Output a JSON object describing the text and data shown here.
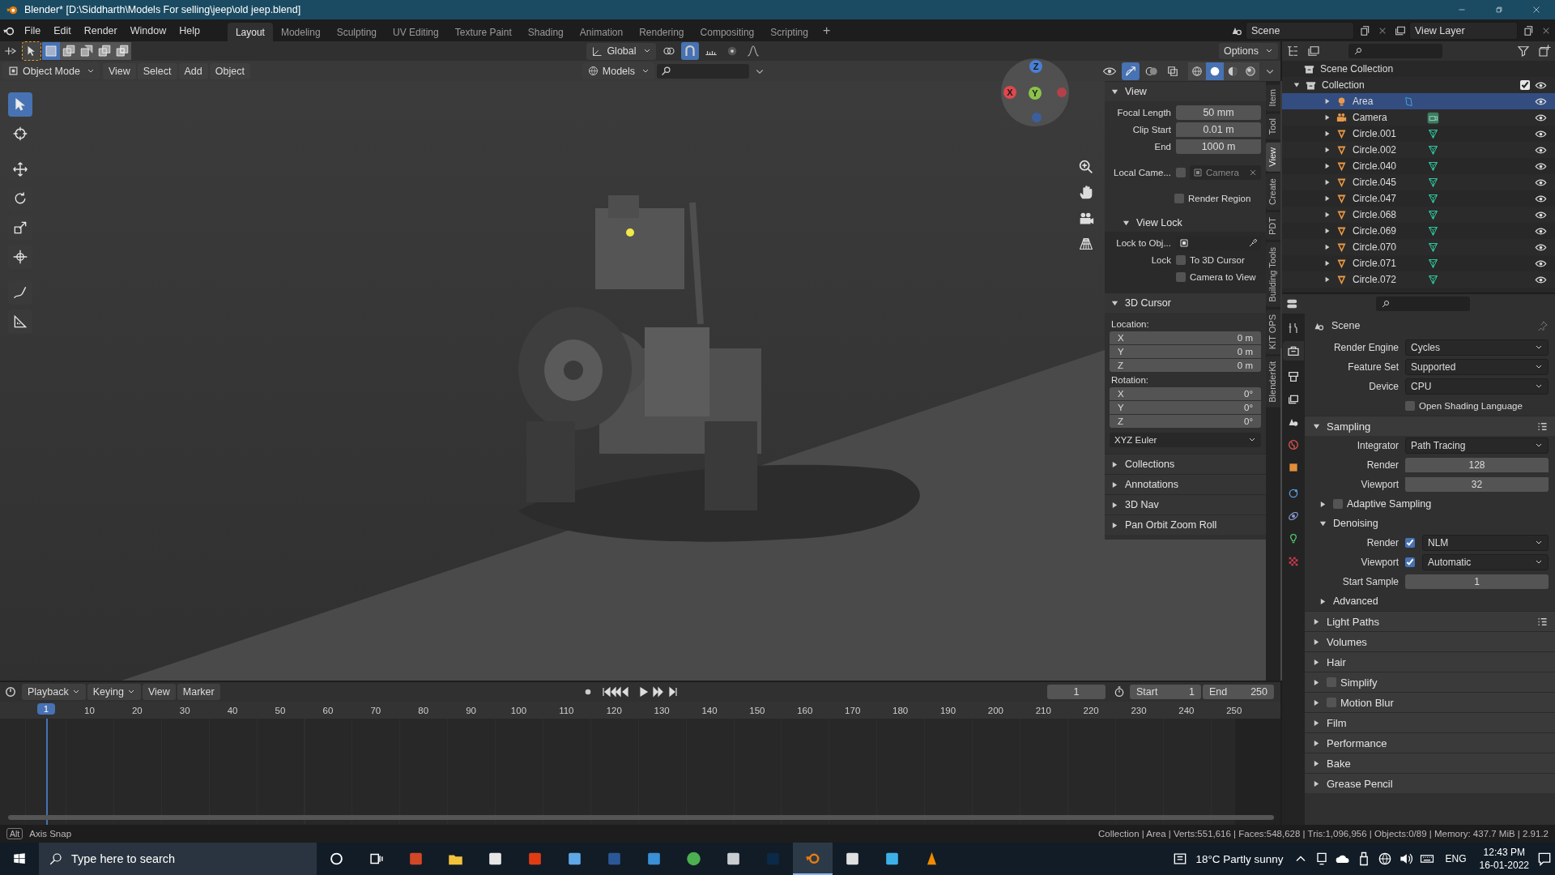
{
  "window": {
    "title": "Blender* [D:\\Siddharth\\Models For selling\\jeep\\old jeep.blend]"
  },
  "menu": [
    "File",
    "Edit",
    "Render",
    "Window",
    "Help"
  ],
  "workspaces": [
    {
      "label": "Layout",
      "selected": true
    },
    {
      "label": "Modeling",
      "selected": false
    },
    {
      "label": "Sculpting",
      "selected": false
    },
    {
      "label": "UV Editing",
      "selected": false
    },
    {
      "label": "Texture Paint",
      "selected": false
    },
    {
      "label": "Shading",
      "selected": false
    },
    {
      "label": "Animation",
      "selected": false
    },
    {
      "label": "Rendering",
      "selected": false
    },
    {
      "label": "Compositing",
      "selected": false
    },
    {
      "label": "Scripting",
      "selected": false
    }
  ],
  "add_workspace": "+",
  "scene": "Scene",
  "view_layer": "View Layer",
  "tool_header": {
    "orientation": "Global",
    "options": "Options",
    "select_modes": [
      {
        "kind": "set",
        "selected": true
      },
      {
        "kind": "extend",
        "selected": false
      },
      {
        "kind": "subtract",
        "selected": false
      },
      {
        "kind": "difference",
        "selected": false
      },
      {
        "kind": "intersect",
        "selected": false
      }
    ]
  },
  "viewport_header": {
    "mode": "Object Mode",
    "menus": [
      "View",
      "Select",
      "Add",
      "Object"
    ],
    "collection": "Models",
    "shading": [
      {
        "kind": "wireframe",
        "selected": false
      },
      {
        "kind": "solid",
        "selected": true
      },
      {
        "kind": "material",
        "selected": false
      },
      {
        "kind": "rendered",
        "selected": false
      }
    ]
  },
  "toolbar": [
    {
      "kind": "select",
      "selected": true
    },
    {
      "kind": "cursor",
      "selected": false
    },
    {
      "kind": "move",
      "selected": false
    },
    {
      "kind": "rotate",
      "selected": false
    },
    {
      "kind": "scale",
      "selected": false
    },
    {
      "kind": "transform",
      "selected": false
    },
    {
      "kind": "annotate",
      "selected": false
    },
    {
      "kind": "measure",
      "selected": false
    }
  ],
  "gizmo_axes": [
    {
      "label": "Z",
      "color": "#4a7fd6"
    },
    {
      "label": "X",
      "color": "#e0474d"
    },
    {
      "label": "Y",
      "color": "#8bc34a"
    }
  ],
  "n_panel": {
    "tabs": [
      {
        "label": "Item",
        "selected": false
      },
      {
        "label": "Tool",
        "selected": false
      },
      {
        "label": "View",
        "selected": true
      },
      {
        "label": "Create",
        "selected": false
      },
      {
        "label": "PDT",
        "selected": false
      },
      {
        "label": "Building Tools",
        "selected": false
      },
      {
        "label": "KIT OPS",
        "selected": false
      },
      {
        "label": "BlenderKit",
        "selected": false
      }
    ],
    "view": {
      "title": "View",
      "expanded": true,
      "fields": [
        {
          "label": "Focal Length",
          "value": "50 mm"
        },
        {
          "label": "Clip Start",
          "value": "0.01 m"
        },
        {
          "label": "End",
          "value": "1000 m"
        }
      ],
      "local_camera": {
        "label": "Local Came...",
        "checked": false,
        "value": "Camera",
        "disabled": true
      },
      "render_region": {
        "label": "Render Region",
        "checked": false
      },
      "view_lock": {
        "title": "View Lock",
        "expanded": true,
        "object_label": "Lock to Obj...",
        "lock_label": "Lock",
        "options": [
          {
            "label": "To 3D Cursor",
            "checked": false
          },
          {
            "label": "Camera to View",
            "checked": false
          }
        ]
      }
    },
    "cursor": {
      "title": "3D Cursor",
      "expanded": true,
      "location_label": "Location:",
      "location": [
        {
          "axis": "X",
          "value": "0 m"
        },
        {
          "axis": "Y",
          "value": "0 m"
        },
        {
          "axis": "Z",
          "value": "0 m"
        }
      ],
      "rotation_label": "Rotation:",
      "rotation": [
        {
          "axis": "X",
          "value": "0°"
        },
        {
          "axis": "Y",
          "value": "0°"
        },
        {
          "axis": "Z",
          "value": "0°"
        }
      ],
      "rotation_mode": "XYZ Euler"
    },
    "collapsed": [
      {
        "title": "Collections",
        "expanded": false
      },
      {
        "title": "Annotations",
        "expanded": false
      },
      {
        "title": "3D Nav",
        "expanded": false
      },
      {
        "title": "Pan Orbit Zoom Roll",
        "expanded": false
      }
    ]
  },
  "outliner": {
    "root": "Scene Collection",
    "collection": {
      "name": "Collection",
      "checked": true,
      "expanded": true,
      "children": [
        {
          "name": "Area",
          "kind": "light",
          "selected": true
        },
        {
          "name": "Camera",
          "kind": "camera",
          "selected": false
        },
        {
          "name": "Circle.001",
          "kind": "mesh",
          "selected": false
        },
        {
          "name": "Circle.002",
          "kind": "mesh",
          "selected": false
        },
        {
          "name": "Circle.040",
          "kind": "mesh",
          "selected": false
        },
        {
          "name": "Circle.045",
          "kind": "mesh",
          "selected": false
        },
        {
          "name": "Circle.047",
          "kind": "mesh",
          "selected": false
        },
        {
          "name": "Circle.068",
          "kind": "mesh",
          "selected": false
        },
        {
          "name": "Circle.069",
          "kind": "mesh",
          "selected": false
        },
        {
          "name": "Circle.070",
          "kind": "mesh",
          "selected": false
        },
        {
          "name": "Circle.071",
          "kind": "mesh",
          "selected": false
        },
        {
          "name": "Circle.072",
          "kind": "mesh",
          "selected": false
        }
      ]
    }
  },
  "property_tabs": [
    {
      "kind": "tool",
      "selected": false
    },
    {
      "kind": "render",
      "selected": true
    },
    {
      "kind": "output",
      "selected": false
    },
    {
      "kind": "view_layer",
      "selected": false
    },
    {
      "kind": "scene",
      "selected": false
    },
    {
      "kind": "world",
      "selected": false
    },
    {
      "kind": "object",
      "selected": false
    },
    {
      "kind": "physics",
      "selected": false
    },
    {
      "kind": "constraints",
      "selected": false
    },
    {
      "kind": "data",
      "selected": false
    },
    {
      "kind": "texture",
      "selected": false
    }
  ],
  "properties": {
    "title": "Scene",
    "rows": [
      {
        "kind": "dropdown",
        "label": "Render Engine",
        "value": "Cycles"
      },
      {
        "kind": "dropdown",
        "label": "Feature Set",
        "value": "Supported"
      },
      {
        "kind": "dropdown",
        "label": "Device",
        "value": "CPU"
      },
      {
        "kind": "checkbox",
        "label": "Open Shading Language",
        "checked": false
      },
      {
        "kind": "panel",
        "label": "Sampling",
        "expanded": true,
        "presets": true
      },
      {
        "kind": "dropdown",
        "label": "Integrator",
        "value": "Path Tracing"
      },
      {
        "kind": "number",
        "label": "Render",
        "value": "128"
      },
      {
        "kind": "number",
        "label": "Viewport",
        "value": "32"
      },
      {
        "kind": "subpanel",
        "label": "Adaptive Sampling",
        "expanded": false,
        "checked": false
      },
      {
        "kind": "subpanel",
        "label": "Denoising",
        "expanded": true
      },
      {
        "kind": "check_dropdown",
        "label": "Render",
        "checked": true,
        "value": "NLM"
      },
      {
        "kind": "check_dropdown",
        "label": "Viewport",
        "checked": true,
        "value": "Automatic"
      },
      {
        "kind": "number",
        "label": "Start Sample",
        "value": "1"
      },
      {
        "kind": "subpanel",
        "label": "Advanced",
        "expanded": false
      },
      {
        "kind": "panel",
        "label": "Light Paths",
        "expanded": false,
        "presets": true
      },
      {
        "kind": "panel",
        "label": "Volumes",
        "expanded": false
      },
      {
        "kind": "panel",
        "label": "Hair",
        "expanded": false
      },
      {
        "kind": "panel",
        "label": "Simplify",
        "expanded": false,
        "checked": false
      },
      {
        "kind": "panel",
        "label": "Motion Blur",
        "expanded": false,
        "checked": false
      },
      {
        "kind": "panel",
        "label": "Film",
        "expanded": false
      },
      {
        "kind": "panel",
        "label": "Performance",
        "expanded": false
      },
      {
        "kind": "panel",
        "label": "Bake",
        "expanded": false
      },
      {
        "kind": "panel",
        "label": "Grease Pencil",
        "expanded": false
      }
    ]
  },
  "timeline": {
    "menus": [
      "Playback",
      "Keying",
      "View",
      "Marker"
    ],
    "current_frame": "1",
    "start_label": "Start",
    "start": "1",
    "end_label": "End",
    "end": "250",
    "playhead": "1",
    "ticks": [
      "10",
      "20",
      "30",
      "40",
      "50",
      "60",
      "70",
      "80",
      "90",
      "100",
      "110",
      "120",
      "130",
      "140",
      "150",
      "160",
      "170",
      "180",
      "190",
      "200",
      "210",
      "220",
      "230",
      "240",
      "250"
    ]
  },
  "status_bar": {
    "key": "Alt",
    "hint": "Axis Snap",
    "stats": "Collection | Area | Verts:551,616 | Faces:548,628 | Tris:1,096,956 | Objects:0/89 | Memory: 437.7 MiB | 2.91.2"
  },
  "taskbar": {
    "search": {
      "placeholder": "Type here to search"
    },
    "weather": "18°C Partly sunny",
    "language": "ENG",
    "time": "12:43 PM",
    "date": "16-01-2022"
  }
}
